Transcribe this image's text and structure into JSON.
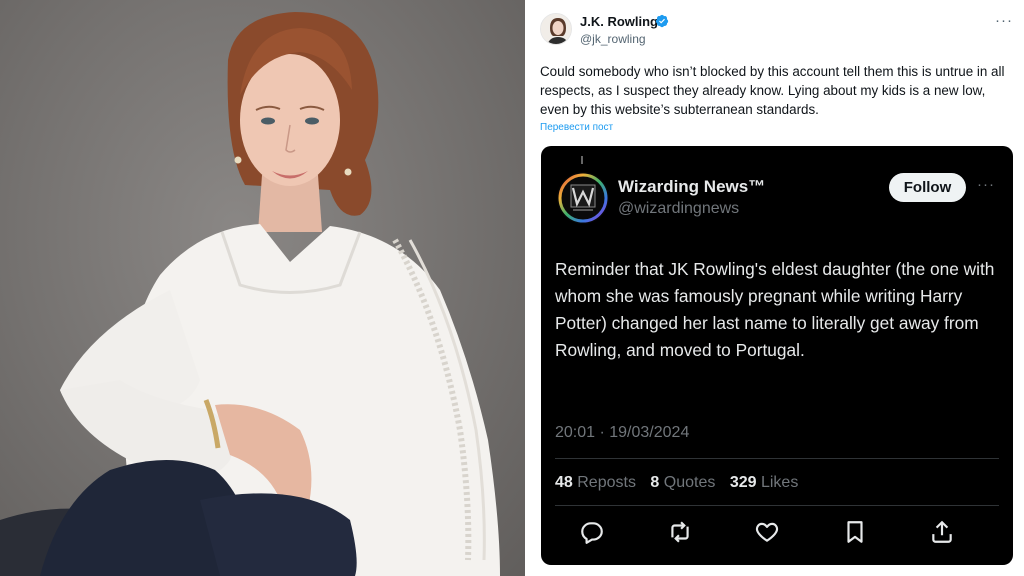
{
  "tweet": {
    "author_name": "J.K. Rowling",
    "author_handle": "@jk_rowling",
    "text": "Could somebody who isn’t blocked by this account tell them this is untrue in all respects, as I suspect they already know. Lying about my kids is a new low, even by this website’s subterranean standards.",
    "translate_label": "Перевести пост",
    "more_label": "···"
  },
  "quoted": {
    "name": "Wizarding News™",
    "handle": "@wizardingnews",
    "follow_label": "Follow",
    "more_label": "···",
    "text": "Reminder that JK Rowling's eldest daughter (the one with whom she was famously pregnant while writing Harry Potter) changed her last name to literally get away from Rowling, and moved to Portugal.",
    "timestamp": "20:01 · 19/03/2024",
    "stats": {
      "reposts_count": "48",
      "reposts_label": "Reposts",
      "quotes_count": "8",
      "quotes_label": "Quotes",
      "likes_count": "329",
      "likes_label": "Likes"
    },
    "actions": [
      "reply-icon",
      "repost-icon",
      "like-icon",
      "bookmark-icon",
      "share-icon"
    ]
  },
  "colors": {
    "accent": "#1d9bf0",
    "dark_bg": "#000000",
    "muted": "#71767b"
  }
}
